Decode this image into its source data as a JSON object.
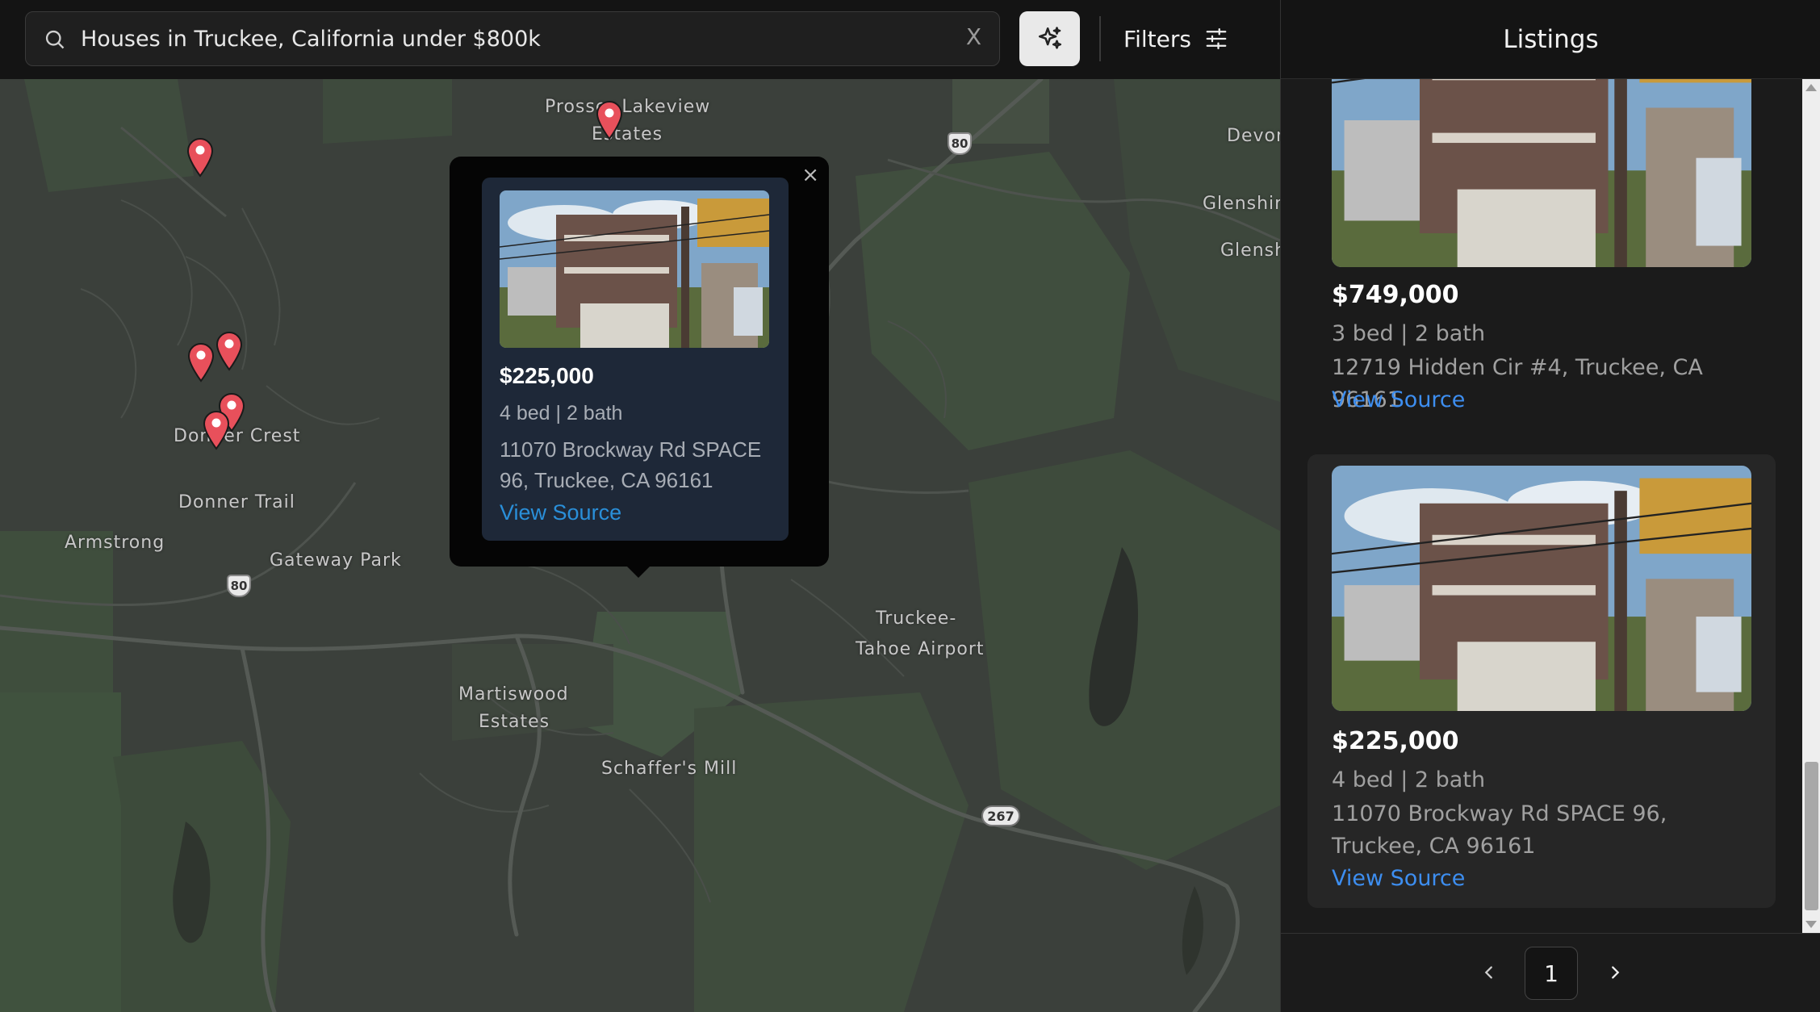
{
  "search": {
    "value": "Houses in Truckee, California under $800k",
    "placeholder": "Search",
    "clear_label": "X",
    "icon": "search-icon"
  },
  "toolbar": {
    "ai_icon": "sparkle-icon",
    "filters_label": "Filters",
    "filters_icon": "sliders-icon"
  },
  "map": {
    "labels": [
      {
        "text": "Prosser Lakeview"
      },
      {
        "text": "Estates"
      },
      {
        "text": "Devon"
      },
      {
        "text": "Glenshire"
      },
      {
        "text": "Glensh"
      },
      {
        "text": "Donner Crest"
      },
      {
        "text": "Donner Trail"
      },
      {
        "text": "Armstrong"
      },
      {
        "text": "Gateway Park"
      },
      {
        "text": "Truckee-"
      },
      {
        "text": "Tahoe Airport"
      },
      {
        "text": "Martiswood"
      },
      {
        "text": "Estates"
      },
      {
        "text": "Schaffer's Mill"
      }
    ],
    "highways": [
      "80",
      "80",
      "267"
    ],
    "popup": {
      "price": "$225,000",
      "beds": "4 bed | 2 bath",
      "address": "11070 Brockway Rd SPACE 96, Truckee, CA 96161",
      "source_label": "View Source",
      "close_label": "×"
    }
  },
  "sidebar": {
    "title": "Listings",
    "listings": [
      {
        "price": "$749,000",
        "beds": "3 bed | 2 bath",
        "address": "12719 Hidden Cir #4, Truckee, CA 96161",
        "source_label": "View Source"
      },
      {
        "price": "$225,000",
        "beds": "4 bed | 2 bath",
        "address": "11070 Brockway Rd SPACE 96, Truckee, CA 96161",
        "source_label": "View Source"
      }
    ],
    "pagination": {
      "current_page": "1",
      "prev_icon": "chevron-left-icon",
      "next_icon": "chevron-right-icon"
    }
  },
  "colors": {
    "accent_link": "#3d8ef0",
    "pin": "#e8505b",
    "map_base": "#3a3f3a",
    "popup_card": "#1e2838"
  }
}
